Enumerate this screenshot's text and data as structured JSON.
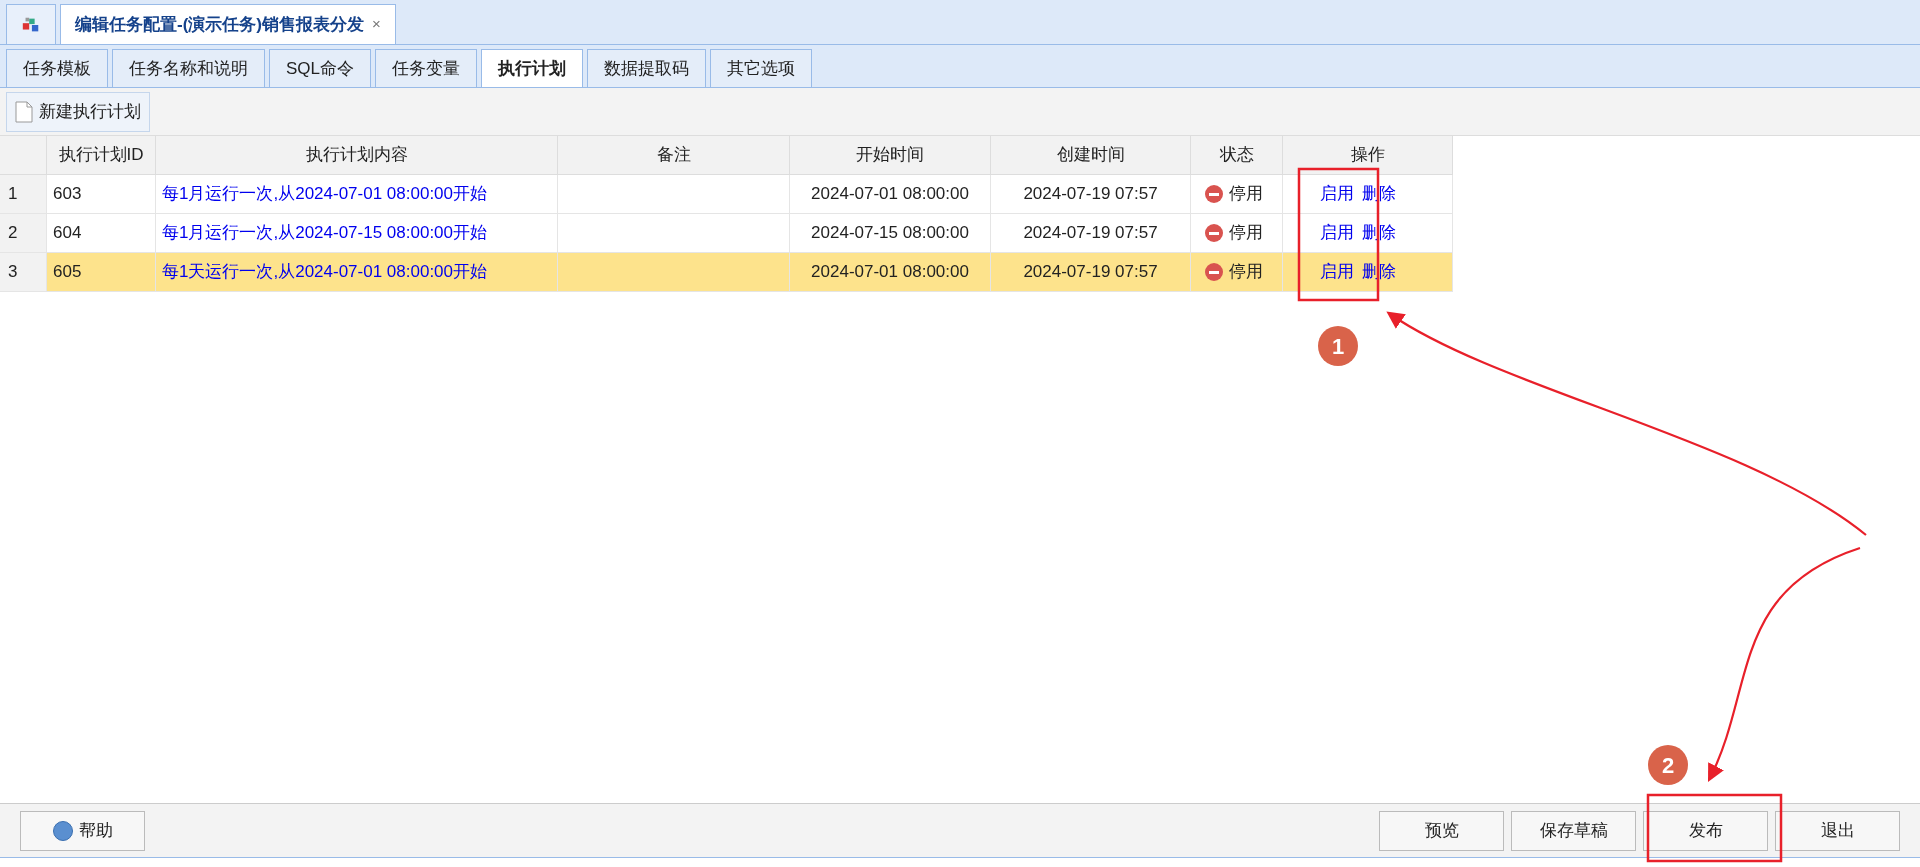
{
  "window_tabs": [
    {
      "kind": "home",
      "selected": false
    },
    {
      "kind": "document",
      "label": "编辑任务配置-(演示任务)销售报表分发",
      "close": "×",
      "selected": true
    }
  ],
  "tabs": [
    {
      "label": "任务模板",
      "selected": false
    },
    {
      "label": "任务名称和说明",
      "selected": false
    },
    {
      "label": "SQL命令",
      "selected": false
    },
    {
      "label": "任务变量",
      "selected": false
    },
    {
      "label": "执行计划",
      "selected": true
    },
    {
      "label": "数据提取码",
      "selected": false
    },
    {
      "label": "其它选项",
      "selected": false
    }
  ],
  "toolbar": {
    "new_button": "新建执行计划"
  },
  "table": {
    "columns": [
      "执行计划ID",
      "执行计划内容",
      "备注",
      "开始时间",
      "创建时间",
      "状态",
      "操作"
    ],
    "rows": [
      {
        "index": "1",
        "id": "603",
        "content": "每1月运行一次,从2024-07-01 08:00:00开始",
        "start": "2024-07-01 08:00:00",
        "created": "2024-07-19 07:57",
        "status": "停用",
        "enabled": false,
        "actions": [
          "启用",
          "删除"
        ],
        "selected": false
      },
      {
        "index": "2",
        "id": "604",
        "content": "每1月运行一次,从2024-07-15 08:00:00开始",
        "start": "2024-07-15 08:00:00",
        "created": "2024-07-19 07:57",
        "status": "停用",
        "enabled": false,
        "actions": [
          "启用",
          "删除"
        ],
        "selected": false
      },
      {
        "index": "3",
        "id": "605",
        "content": "每1天运行一次,从2024-07-01 08:00:00开始",
        "start": "2024-07-01 08:00:00",
        "created": "2024-07-19 07:57",
        "status": "停用",
        "enabled": false,
        "actions": [
          "启用",
          "删除"
        ],
        "selected": true
      }
    ]
  },
  "footer": {
    "help": "帮助",
    "buttons": [
      "预览",
      "保存草稿",
      "发布",
      "退出"
    ]
  },
  "annotations": [
    {
      "label": "1"
    },
    {
      "label": "2"
    }
  ]
}
